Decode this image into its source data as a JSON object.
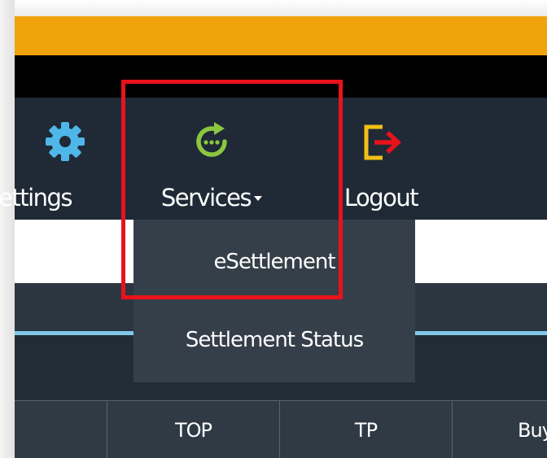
{
  "nav": {
    "settings_label": "ettings",
    "services_label": "Services",
    "logout_label": "Logout"
  },
  "dropdown": {
    "items": [
      {
        "label": "eSettlement"
      },
      {
        "label": "Settlement Status"
      }
    ]
  },
  "table": {
    "headers": [
      "",
      "TOP",
      "TP",
      "Buy"
    ]
  },
  "colors": {
    "top_banner": "#f0a30a",
    "nav_background": "#1f2a36",
    "settings_icon": "#4fb6ea",
    "services_icon": "#8cc63f",
    "logout_icon_door": "#f2c014",
    "logout_icon_arrow": "#e8121c",
    "highlight_box": "#e8121c",
    "accent_rule": "#7fc9ea"
  },
  "icons": {
    "settings": "gear-icon",
    "services": "refresh-dots-icon",
    "logout": "logout-icon"
  }
}
